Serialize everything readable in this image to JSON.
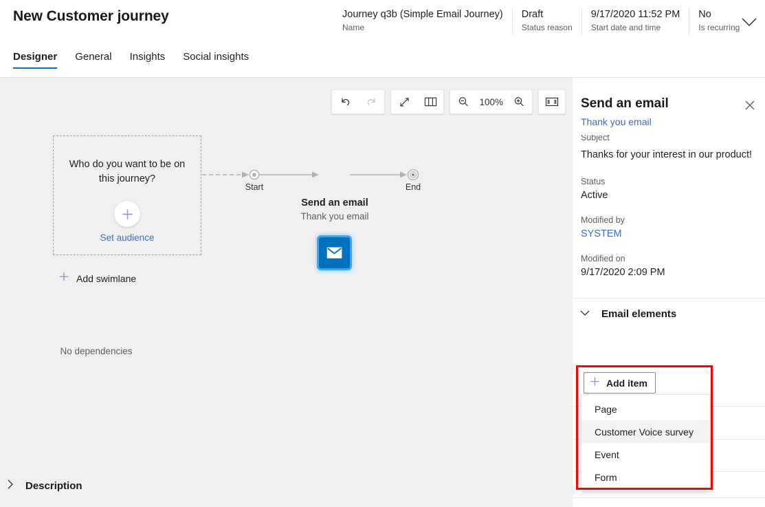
{
  "header": {
    "title": "New Customer journey",
    "meta": [
      {
        "value": "Journey q3b (Simple Email Journey)",
        "label": "Name"
      },
      {
        "value": "Draft",
        "label": "Status reason"
      },
      {
        "value": "9/17/2020 11:52 PM",
        "label": "Start date and time"
      },
      {
        "value": "No",
        "label": "Is recurring"
      }
    ],
    "expand_icon": "chevron-down-icon"
  },
  "tabs": [
    {
      "label": "Designer",
      "active": true
    },
    {
      "label": "General",
      "active": false
    },
    {
      "label": "Insights",
      "active": false
    },
    {
      "label": "Social insights",
      "active": false
    }
  ],
  "toolbar": {
    "undo": "undo-icon",
    "redo": "redo-icon",
    "expand": "expand-diagonal-icon",
    "minimap": "map-icon",
    "zoom_out": "zoom-out-icon",
    "zoom_level": "100%",
    "zoom_in": "zoom-in-icon",
    "fit_to_screen": "fit-to-screen-icon"
  },
  "canvas": {
    "audience": {
      "question": "Who do you want to be on this journey?",
      "plus_icon": "plus-icon",
      "link": "Set audience"
    },
    "start_label": "Start",
    "end_label": "End",
    "email_node": {
      "icon": "envelope-icon",
      "title": "Send an email",
      "subtitle": "Thank you email"
    },
    "add_swimlane": {
      "icon": "plus-icon",
      "label": "Add swimlane"
    }
  },
  "panel": {
    "title": "Send an email",
    "close_icon": "close-icon",
    "subtitle": "Thank you email",
    "fields": [
      {
        "label": "Subject",
        "value": "Thanks for your interest in our product!",
        "link": false
      },
      {
        "label": "Status",
        "value": "Active",
        "link": false
      },
      {
        "label": "Modified by",
        "value": "SYSTEM",
        "link": true
      },
      {
        "label": "Modified on",
        "value": "9/17/2020 2:09 PM",
        "link": false
      }
    ],
    "email_elements": {
      "chevron": "chevron-down-icon",
      "title": "Email elements",
      "empty_text": "No dependencies",
      "add_item": {
        "icon": "plus-icon",
        "label": "Add item"
      },
      "dropdown_options": [
        {
          "label": "Page",
          "hovered": false
        },
        {
          "label": "Customer Voice survey",
          "hovered": true
        },
        {
          "label": "Event",
          "hovered": false
        },
        {
          "label": "Form",
          "hovered": false
        }
      ]
    },
    "description_section": {
      "chevron": "chevron-right-icon",
      "title": "Description"
    }
  },
  "colors": {
    "accent": "#0f6cbd",
    "link": "#3b6ec6",
    "node_blue": "#0071bc",
    "node_glow": "#3fa5ef",
    "annotation_red": "#ff0000",
    "canvas_bg": "#f0f0f0"
  }
}
